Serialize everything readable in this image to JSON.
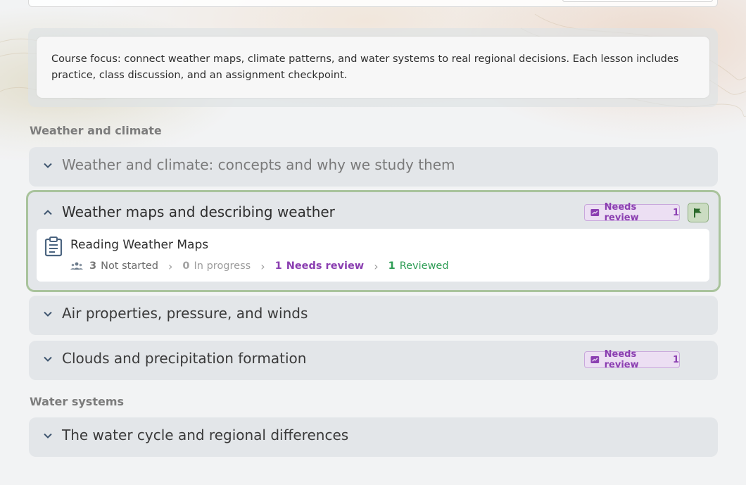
{
  "course_focus": "Course focus: connect weather maps, climate patterns, and water systems to real regional decisions. Each lesson includes practice, class discussion, and an assignment checkpoint.",
  "colors": {
    "needs_review": "#8b3fb1",
    "reviewed": "#2f9d56",
    "highlight_border": "#a9c39c"
  },
  "sections": [
    {
      "label": "Weather and climate",
      "units": [
        {
          "title": "Weather and climate: concepts and why we study them",
          "expanded": false
        },
        {
          "title": "Weather maps and describing weather",
          "expanded": true,
          "badge": {
            "label": "Needs review",
            "count": "1",
            "icon": "review-icon"
          },
          "flag_icon": "flag-icon",
          "lessons": [
            {
              "title": "Reading Weather Maps",
              "icon": "clipboard-icon",
              "progress": {
                "not_started": {
                  "count": "3",
                  "label": "Not started"
                },
                "in_progress": {
                  "count": "0",
                  "label": "In progress"
                },
                "needs_review": {
                  "count": "1",
                  "label": "Needs review"
                },
                "reviewed": {
                  "count": "1",
                  "label": "Reviewed"
                }
              }
            }
          ]
        },
        {
          "title": "Air properties, pressure, and winds",
          "expanded": false
        },
        {
          "title": "Clouds and precipitation formation",
          "expanded": false,
          "badge": {
            "label": "Needs review",
            "count": "1",
            "icon": "review-icon"
          }
        }
      ]
    },
    {
      "label": "Water systems",
      "units": [
        {
          "title": "The water cycle and regional differences",
          "expanded": false
        }
      ]
    }
  ]
}
